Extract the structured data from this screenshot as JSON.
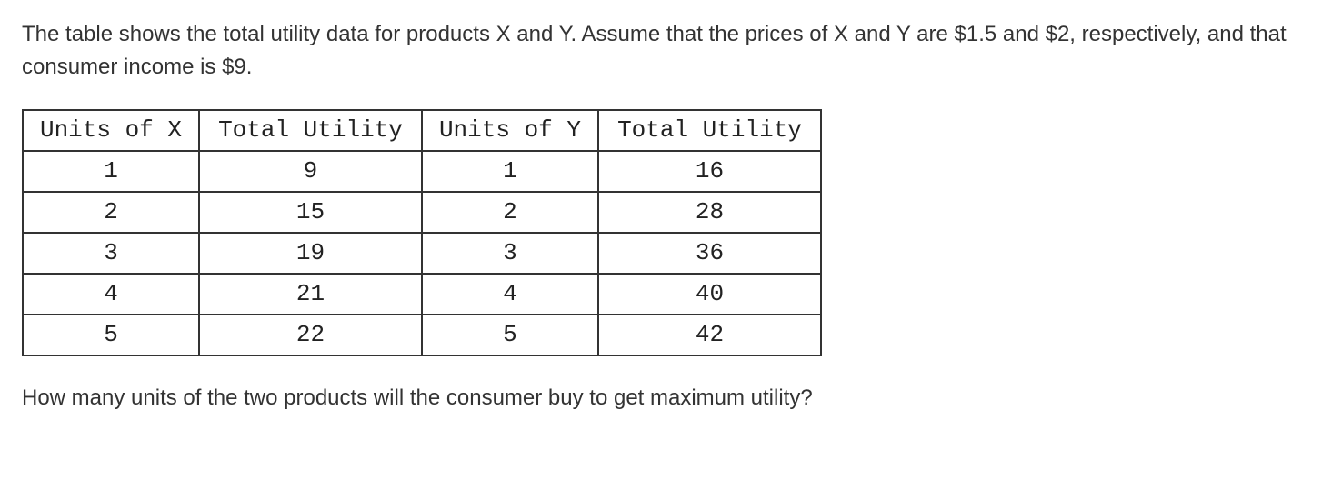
{
  "intro": "The table shows the total utility data for products X and Y. Assume that the prices of X and Y are $1.5 and $2, respectively, and that consumer income is $9.",
  "question": "How many units of the two products will the consumer buy to get maximum utility?",
  "table": {
    "headers": [
      "Units of X",
      "Total Utility",
      "Units of Y",
      "Total Utility"
    ],
    "rows": [
      {
        "ux": "1",
        "tux": "9",
        "uy": "1",
        "tuy": "16"
      },
      {
        "ux": "2",
        "tux": "15",
        "uy": "2",
        "tuy": "28"
      },
      {
        "ux": "3",
        "tux": "19",
        "uy": "3",
        "tuy": "36"
      },
      {
        "ux": "4",
        "tux": "21",
        "uy": "4",
        "tuy": "40"
      },
      {
        "ux": "5",
        "tux": "22",
        "uy": "5",
        "tuy": "42"
      }
    ]
  },
  "chart_data": {
    "type": "table",
    "title": "Total utility data for products X and Y",
    "columns": [
      "Units of X",
      "Total Utility (X)",
      "Units of Y",
      "Total Utility (Y)"
    ],
    "data": [
      [
        1,
        9,
        1,
        16
      ],
      [
        2,
        15,
        2,
        28
      ],
      [
        3,
        19,
        3,
        36
      ],
      [
        4,
        21,
        4,
        40
      ],
      [
        5,
        22,
        5,
        42
      ]
    ],
    "context": {
      "price_X": 1.5,
      "price_Y": 2,
      "income": 9
    }
  }
}
